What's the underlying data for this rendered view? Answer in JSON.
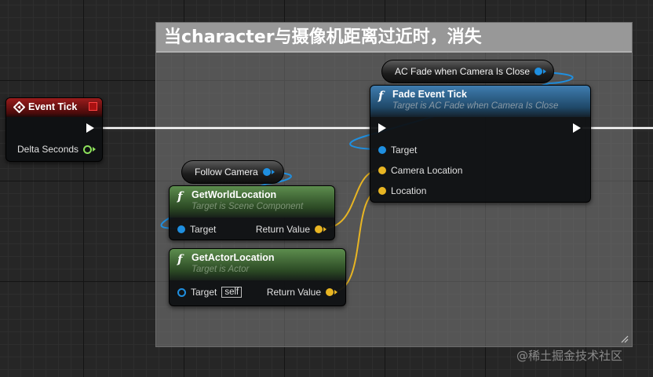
{
  "comment": {
    "title": "当character与摄像机距离过近时，消失"
  },
  "event_tick": {
    "title": "Event Tick",
    "pin_delta": "Delta Seconds"
  },
  "fade_var": {
    "label": "AC Fade when Camera Is Close"
  },
  "fade_node": {
    "title": "Fade Event Tick",
    "subtitle": "Target is AC Fade when Camera Is Close",
    "pins": [
      "Target",
      "Camera Location",
      "Location"
    ]
  },
  "follow_var": {
    "label": "Follow Camera"
  },
  "get_world": {
    "title": "GetWorldLocation",
    "subtitle": "Target is Scene Component",
    "pin_target": "Target",
    "pin_return": "Return Value"
  },
  "get_actor": {
    "title": "GetActorLocation",
    "subtitle": "Target is Actor",
    "pin_target": "Target",
    "self_label": "self",
    "pin_return": "Return Value"
  },
  "watermark": "@稀土掘金技术社区",
  "colors": {
    "exec_wire": "#ffffff",
    "object_pin": "#1f8fe0",
    "vector_pin": "#e8b523",
    "float_pin": "#8de05b",
    "event_header": "#9a1c1c",
    "function_header": "#3f7db0",
    "pure_function_header": "#5d8d4e"
  }
}
